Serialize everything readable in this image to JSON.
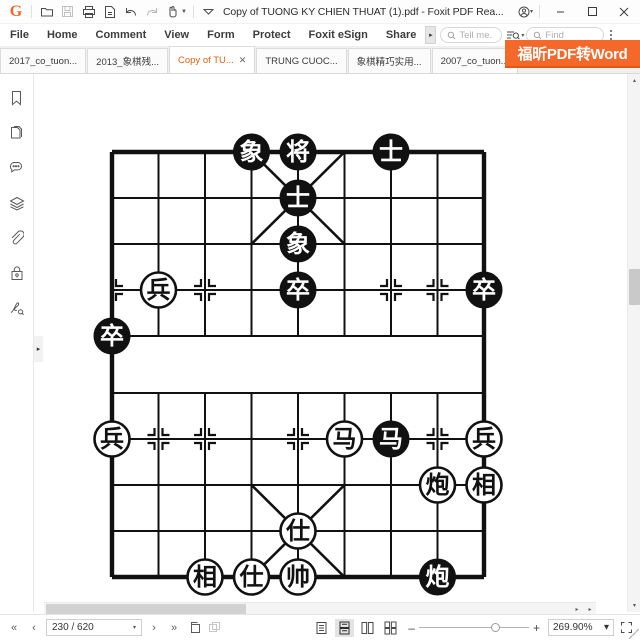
{
  "window": {
    "title": "Copy of TUONG KY CHIEN THUAT (1).pdf - Foxit PDF Rea...",
    "minimize": "—",
    "maximize": "☐",
    "close": "✕",
    "account_caret": "▾"
  },
  "quick_access": [
    {
      "name": "open-icon",
      "label": "Open"
    },
    {
      "name": "save-icon",
      "label": "Save"
    },
    {
      "name": "print-icon",
      "label": "Print"
    },
    {
      "name": "print-preview-icon",
      "label": "Print Preview"
    },
    {
      "name": "undo-icon",
      "label": "Undo"
    },
    {
      "name": "redo-icon",
      "label": "Redo"
    },
    {
      "name": "hand-tool-icon",
      "label": "Hand Tool"
    }
  ],
  "menu": {
    "items": [
      {
        "label": "File"
      },
      {
        "label": "Home"
      },
      {
        "label": "Comment"
      },
      {
        "label": "View"
      },
      {
        "label": "Form"
      },
      {
        "label": "Protect"
      },
      {
        "label": "Foxit eSign"
      },
      {
        "label": "Share"
      }
    ],
    "overflow_arrow": "▸",
    "tell_me_placeholder": "Tell me.",
    "find_placeholder": "Find",
    "search_options_caret": "▾"
  },
  "tabs": {
    "items": [
      {
        "label": "2017_co_tuon...",
        "active": false,
        "closable": false
      },
      {
        "label": "2013_象棋残...",
        "active": false,
        "closable": false
      },
      {
        "label": "Copy of TU...",
        "active": true,
        "closable": true
      },
      {
        "label": "TRUNG CUOC...",
        "active": false,
        "closable": false
      },
      {
        "label": "象棋精巧实用...",
        "active": false,
        "closable": false
      },
      {
        "label": "2007_co_tuon...",
        "active": false,
        "closable": false
      }
    ],
    "close_glyph": "✕",
    "overflow_glyph": "▾"
  },
  "promo_banner": {
    "text": "福昕PDF转Word",
    "color": "#f4692a"
  },
  "rail": {
    "items": [
      {
        "name": "bookmark-icon",
        "label": "Bookmarks"
      },
      {
        "name": "pages-icon",
        "label": "Page Thumbnails"
      },
      {
        "name": "comments-icon",
        "label": "Comments"
      },
      {
        "name": "layers-icon",
        "label": "Layers"
      },
      {
        "name": "attachments-icon",
        "label": "Attachments"
      },
      {
        "name": "security-lock-icon",
        "label": "Security"
      },
      {
        "name": "signature-icon",
        "label": "Digital Signatures"
      }
    ],
    "expand_glyph": "▸"
  },
  "scrollbars": {
    "v_up": "▴",
    "v_down": "▾",
    "h_left": "◂",
    "h_right": "▸"
  },
  "statusbar": {
    "first_page": "«",
    "prev_page": "‹",
    "page_value": "230 / 620",
    "page_caret": "▾",
    "next_page": "›",
    "last_page": "»",
    "view_modes": [
      {
        "name": "single-page-view",
        "selected": false
      },
      {
        "name": "continuous-page-view",
        "selected": true
      },
      {
        "name": "two-page-view",
        "selected": false
      },
      {
        "name": "two-page-continuous-view",
        "selected": false
      }
    ],
    "zoom_out": "–",
    "zoom_in": "+",
    "zoom_value": "269.90%",
    "zoom_caret": "▾",
    "fullscreen": "⤡"
  },
  "chart_data": {
    "type": "diagram",
    "title": "Xiangqi (Chinese chess) endgame position diagram",
    "board": {
      "files": 9,
      "ranks": 10,
      "river_between_ranks": [
        5,
        6
      ],
      "palace_top_files": [
        4,
        6
      ],
      "palace_bottom_files": [
        4,
        6
      ]
    },
    "pieces": [
      {
        "glyph": "象",
        "side": "black",
        "file": 4,
        "rank": 1,
        "name": "black-elephant"
      },
      {
        "glyph": "将",
        "side": "black",
        "file": 5,
        "rank": 1,
        "name": "black-general"
      },
      {
        "glyph": "士",
        "side": "black",
        "file": 7,
        "rank": 1,
        "name": "black-advisor-1"
      },
      {
        "glyph": "士",
        "side": "black",
        "file": 5,
        "rank": 2,
        "name": "black-advisor-2"
      },
      {
        "glyph": "象",
        "side": "black",
        "file": 5,
        "rank": 3,
        "name": "black-elephant-2"
      },
      {
        "glyph": "卒",
        "side": "black",
        "file": 5,
        "rank": 4,
        "name": "black-pawn-1"
      },
      {
        "glyph": "卒",
        "side": "black",
        "file": 9,
        "rank": 4,
        "name": "black-pawn-2"
      },
      {
        "glyph": "兵",
        "side": "red",
        "file": 2,
        "rank": 4,
        "name": "red-pawn-1"
      },
      {
        "glyph": "卒",
        "side": "black",
        "file": 1,
        "rank": 5,
        "name": "black-pawn-3"
      },
      {
        "glyph": "兵",
        "side": "red",
        "file": 1,
        "rank": 7,
        "name": "red-pawn-2"
      },
      {
        "glyph": "马",
        "side": "red",
        "file": 6,
        "rank": 7,
        "name": "red-horse"
      },
      {
        "glyph": "马",
        "side": "black",
        "file": 7,
        "rank": 7,
        "name": "black-horse"
      },
      {
        "glyph": "兵",
        "side": "red",
        "file": 9,
        "rank": 7,
        "name": "red-pawn-3"
      },
      {
        "glyph": "炮",
        "side": "red",
        "file": 8,
        "rank": 8,
        "name": "red-cannon"
      },
      {
        "glyph": "相",
        "side": "red",
        "file": 9,
        "rank": 8,
        "name": "red-elephant-1"
      },
      {
        "glyph": "仕",
        "side": "red",
        "file": 5,
        "rank": 9,
        "name": "red-advisor-1"
      },
      {
        "glyph": "相",
        "side": "red",
        "file": 3,
        "rank": 10,
        "name": "red-elephant-2"
      },
      {
        "glyph": "仕",
        "side": "red",
        "file": 4,
        "rank": 10,
        "name": "red-advisor-2"
      },
      {
        "glyph": "帅",
        "side": "red",
        "file": 5,
        "rank": 10,
        "name": "red-general"
      },
      {
        "glyph": "炮",
        "side": "black",
        "file": 8,
        "rank": 10,
        "name": "black-cannon"
      }
    ]
  }
}
